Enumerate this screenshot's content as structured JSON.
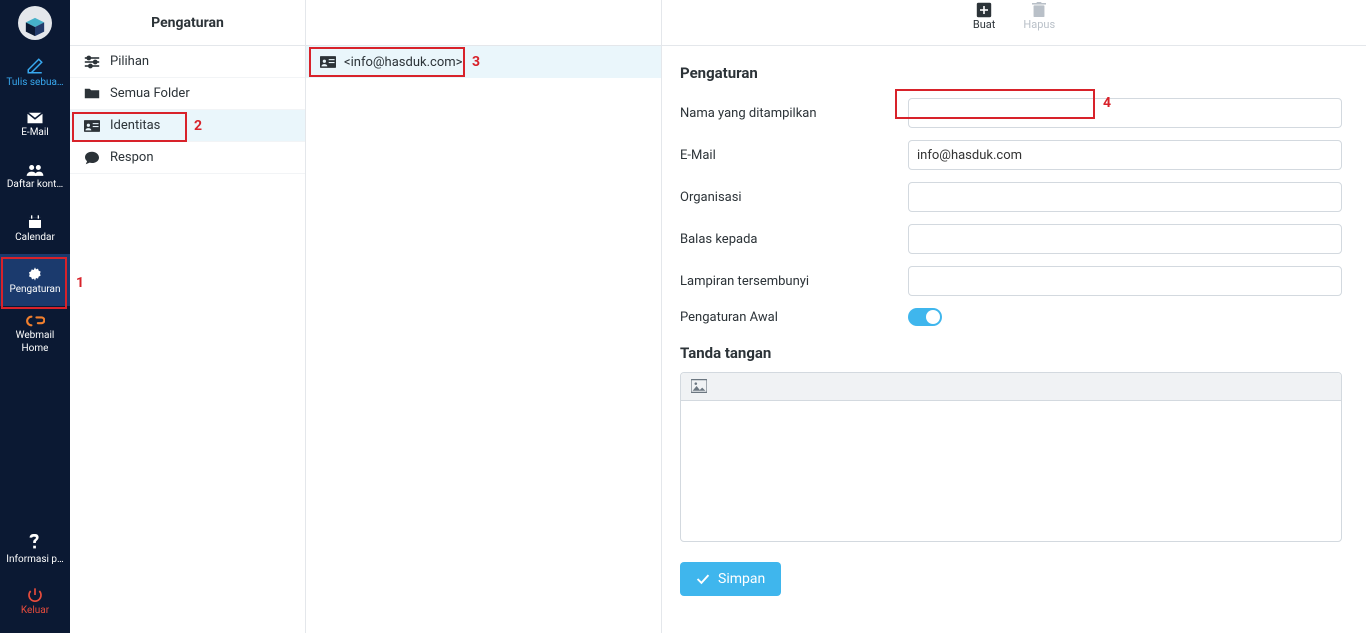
{
  "nav": {
    "compose": "Tulis sebua…",
    "mail": "E-Mail",
    "contacts": "Daftar kont…",
    "calendar": "Calendar",
    "settings": "Pengaturan",
    "webmail_home_l1": "Webmail",
    "webmail_home_l2": "Home",
    "help": "Informasi p…",
    "logout": "Keluar"
  },
  "annotations": {
    "n1": "1",
    "n2": "2",
    "n3": "3",
    "n4": "4"
  },
  "settings_menu": {
    "title": "Pengaturan",
    "items": [
      {
        "label": "Pilihan"
      },
      {
        "label": "Semua Folder"
      },
      {
        "label": "Identitas"
      },
      {
        "label": "Respon"
      }
    ]
  },
  "identity_list": {
    "items": [
      {
        "label": "<info@hasduk.com>"
      }
    ]
  },
  "toolbar": {
    "create": "Buat",
    "delete": "Hapus"
  },
  "form": {
    "heading": "Pengaturan",
    "display_name_label": "Nama yang ditampilkan",
    "display_name_value": "",
    "email_label": "E-Mail",
    "email_value": "info@hasduk.com",
    "org_label": "Organisasi",
    "org_value": "",
    "reply_label": "Balas kepada",
    "reply_value": "",
    "bcc_label": "Lampiran tersembunyi",
    "bcc_value": "",
    "default_label": "Pengaturan Awal",
    "signature_heading": "Tanda tangan",
    "save": "Simpan"
  }
}
